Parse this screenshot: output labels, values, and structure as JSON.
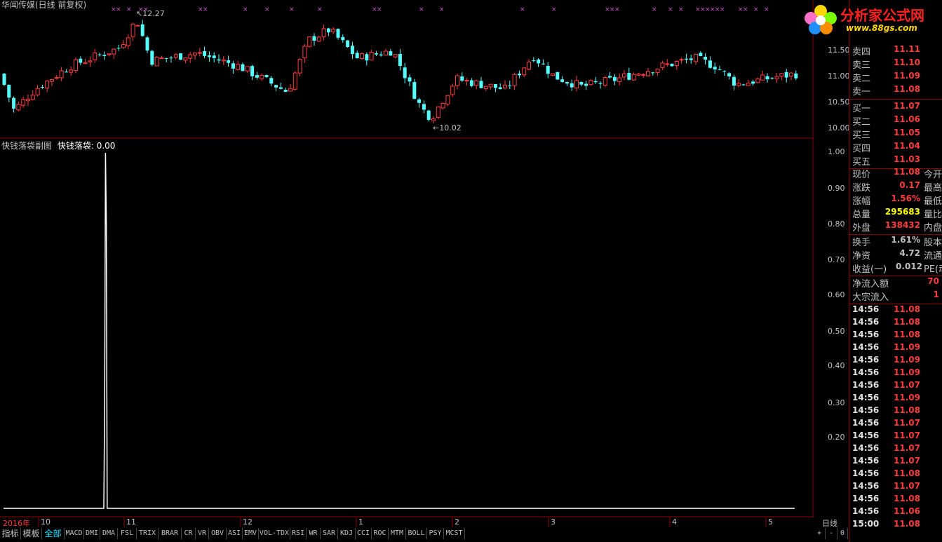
{
  "window": {
    "title": "华闻传媒(日线 前复权)"
  },
  "main_chart": {
    "max_label": "12.27",
    "min_label": "10.02",
    "y_ticks": [
      "11.50",
      "11.00",
      "10.50",
      "10.00"
    ],
    "up_color": "#ff3c3c",
    "down_color": "#54ffff"
  },
  "indicator_panel": {
    "title": "快钱落袋副图",
    "series_label": "快钱落袋:",
    "series_value": "0.00",
    "y_ticks": [
      "1.00",
      "0.90",
      "0.80",
      "0.70",
      "0.60",
      "0.50",
      "0.40",
      "0.30",
      "0.20"
    ],
    "line_color": "#ffffff"
  },
  "chart_data": {
    "type": "line",
    "title": "快钱落袋副图",
    "series": [
      {
        "name": "快钱落袋",
        "x": [
          0,
          22,
          23,
          24,
          25,
          26,
          27,
          28,
          29,
          30,
          31,
          32,
          33,
          34,
          35,
          36,
          37,
          38,
          39,
          40,
          41,
          42,
          43,
          44,
          45,
          46,
          47,
          48,
          49,
          50,
          200
        ],
        "values": [
          0,
          0,
          0.3,
          1,
          0.8,
          0,
          0,
          0,
          0,
          0,
          0,
          0,
          0,
          0,
          0,
          0,
          0,
          0,
          0,
          0,
          0,
          0,
          0,
          0,
          0,
          0,
          0,
          0,
          0,
          0,
          0
        ]
      }
    ],
    "ylim": [
      0,
      1
    ],
    "grid": false
  },
  "x_axis": {
    "labels": [
      {
        "text": "2016年"
      },
      {
        "text": "10"
      },
      {
        "text": "11"
      },
      {
        "text": "12"
      },
      {
        "text": "1"
      },
      {
        "text": "2"
      },
      {
        "text": "3"
      },
      {
        "text": "4"
      },
      {
        "text": "5"
      }
    ],
    "period_label": "日线"
  },
  "tabs": [
    "指标",
    "模板",
    "全部",
    "MACD",
    "DMI",
    "DMA",
    "FSL",
    "TRIX",
    "BRAR",
    "CR",
    "VR",
    "OBV",
    "ASI",
    "EMV",
    "VOL-TDX",
    "RSI",
    "WR",
    "SAR",
    "KDJ",
    "CCI",
    "ROC",
    "MTM",
    "BOLL",
    "PSY",
    "MCST"
  ],
  "tab_controls": [
    "+",
    "-",
    "0"
  ],
  "logo": {
    "text": "分析家公式网",
    "url_text": "www.88gs.com"
  },
  "quote_panel": {
    "asks": [
      {
        "label": "卖四",
        "value": "11.11"
      },
      {
        "label": "卖三",
        "value": "11.10"
      },
      {
        "label": "卖二",
        "value": "11.09"
      },
      {
        "label": "卖一",
        "value": "11.08"
      }
    ],
    "bids": [
      {
        "label": "买一",
        "value": "11.07"
      },
      {
        "label": "买二",
        "value": "11.06"
      },
      {
        "label": "买三",
        "value": "11.05"
      },
      {
        "label": "买四",
        "value": "11.04"
      },
      {
        "label": "买五",
        "value": "11.03"
      }
    ],
    "stats": [
      {
        "label": "现价",
        "value": "11.08",
        "extra": "今开",
        "color": "#ff3c3c"
      },
      {
        "label": "涨跌",
        "value": "0.17",
        "extra": "最高",
        "color": "#ff3c3c"
      },
      {
        "label": "涨幅",
        "value": "1.56%",
        "extra": "最低",
        "color": "#ff3c3c"
      },
      {
        "label": "总量",
        "value": "295683",
        "extra": "量比",
        "color": "#ffff00"
      },
      {
        "label": "外盘",
        "value": "138432",
        "extra": "内盘",
        "color": "#ff3c3c"
      }
    ],
    "stats2": [
      {
        "label": "换手",
        "value": "1.61%",
        "extra": "股本",
        "color": "#c0c0c0"
      },
      {
        "label": "净资",
        "value": "4.72",
        "extra": "流通",
        "color": "#c0c0c0"
      },
      {
        "label": "收益(一)",
        "value": "0.012",
        "extra": "PE(动",
        "color": "#c0c0c0"
      }
    ],
    "flows": [
      {
        "label": "净流入额",
        "value": "70"
      },
      {
        "label": "大宗流入",
        "value": "1"
      }
    ],
    "ticks": [
      {
        "time": "14:56",
        "price": "11.08",
        "color": "#ff3c3c"
      },
      {
        "time": "14:56",
        "price": "11.08",
        "color": "#ff3c3c"
      },
      {
        "time": "14:56",
        "price": "11.08",
        "color": "#ff3c3c"
      },
      {
        "time": "14:56",
        "price": "11.09",
        "color": "#ff3c3c"
      },
      {
        "time": "14:56",
        "price": "11.09",
        "color": "#ff3c3c"
      },
      {
        "time": "14:56",
        "price": "11.09",
        "color": "#ff3c3c"
      },
      {
        "time": "14:56",
        "price": "11.07",
        "color": "#ff3c3c"
      },
      {
        "time": "14:56",
        "price": "11.09",
        "color": "#ff3c3c"
      },
      {
        "time": "14:56",
        "price": "11.08",
        "color": "#ff3c3c"
      },
      {
        "time": "14:56",
        "price": "11.07",
        "color": "#ff3c3c"
      },
      {
        "time": "14:56",
        "price": "11.07",
        "color": "#ff3c3c"
      },
      {
        "time": "14:56",
        "price": "11.07",
        "color": "#ff3c3c"
      },
      {
        "time": "14:56",
        "price": "11.07",
        "color": "#ff3c3c"
      },
      {
        "time": "14:56",
        "price": "11.08",
        "color": "#ff3c3c"
      },
      {
        "time": "14:56",
        "price": "11.07",
        "color": "#ff3c3c"
      },
      {
        "time": "14:56",
        "price": "11.08",
        "color": "#ff3c3c"
      },
      {
        "time": "14:56",
        "price": "11.06",
        "color": "#ff3c3c"
      },
      {
        "time": "15:00",
        "price": "11.08",
        "color": "#ff3c3c"
      }
    ]
  }
}
